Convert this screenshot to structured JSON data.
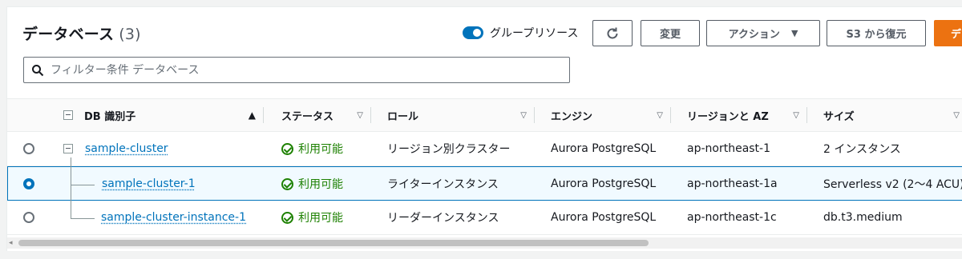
{
  "header": {
    "title": "データベース",
    "count": "(3)",
    "group_toggle_label": "グループリソース",
    "change_label": "変更",
    "actions_label": "アクション",
    "restore_s3_label": "S3 から復元",
    "primary_label": "デ"
  },
  "search": {
    "placeholder": "フィルター条件 データベース"
  },
  "columns": {
    "id": "DB 識別子",
    "status": "ステータス",
    "role": "ロール",
    "engine": "エンジン",
    "region": "リージョンと AZ",
    "size": "サイズ"
  },
  "rows": [
    {
      "id": "sample-cluster",
      "status": "利用可能",
      "role": "リージョン別クラスター",
      "engine": "Aurora PostgreSQL",
      "region": "ap-northeast-1",
      "size": "2 インスタンス",
      "selected": false
    },
    {
      "id": "sample-cluster-1",
      "status": "利用可能",
      "role": "ライターインスタンス",
      "engine": "Aurora PostgreSQL",
      "region": "ap-northeast-1a",
      "size": "Serverless v2 (2〜4 ACU)",
      "selected": true
    },
    {
      "id": "sample-cluster-instance-1",
      "status": "利用可能",
      "role": "リーダーインスタンス",
      "engine": "Aurora PostgreSQL",
      "region": "ap-northeast-1c",
      "size": "db.t3.medium",
      "selected": false
    }
  ],
  "colors": {
    "accent": "#0073bb",
    "primary": "#ec7211",
    "success": "#1d8102"
  }
}
